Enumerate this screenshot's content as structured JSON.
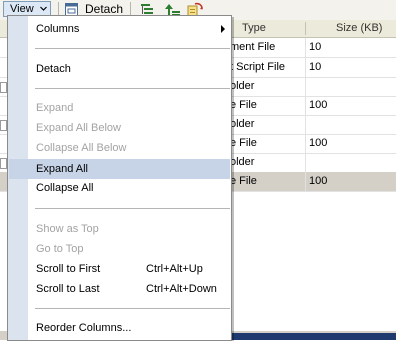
{
  "toolbar": {
    "view_label": "View",
    "detach_label": "Detach"
  },
  "table": {
    "headers": {
      "type": "Type",
      "size": "Size (KB)"
    },
    "rows": [
      {
        "type": "ment File",
        "size": "10"
      },
      {
        "type": "t Script File",
        "size": "10"
      },
      {
        "type": "older",
        "size": ""
      },
      {
        "type": "e File",
        "size": "100"
      },
      {
        "type": "older",
        "size": ""
      },
      {
        "type": "e File",
        "size": "100"
      },
      {
        "type": "older",
        "size": ""
      },
      {
        "type": "e File",
        "size": "100"
      }
    ]
  },
  "menu": {
    "columns": "Columns",
    "detach": "Detach",
    "expand": "Expand",
    "expand_all_below": "Expand All Below",
    "collapse_all_below": "Collapse All Below",
    "expand_all": "Expand All",
    "collapse_all": "Collapse All",
    "show_as_top": "Show as Top",
    "go_to_top": "Go to Top",
    "scroll_to_first": "Scroll to First",
    "scroll_to_first_shortcut": "Ctrl+Alt+Up",
    "scroll_to_last": "Scroll to Last",
    "scroll_to_last_shortcut": "Ctrl+Alt+Down",
    "reorder_columns": "Reorder Columns..."
  },
  "colors": {
    "menu_highlight": "#c7d4e8",
    "menu_gutter": "#dbe3ee",
    "selected_row": "#d4d0c8"
  }
}
